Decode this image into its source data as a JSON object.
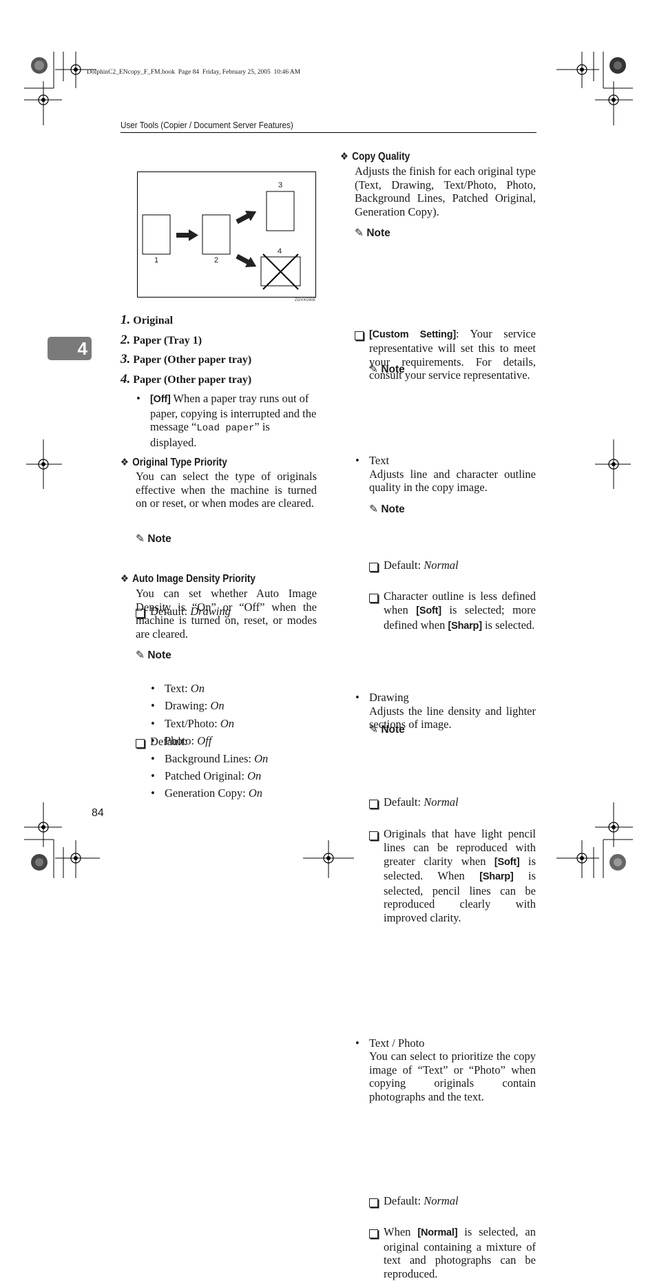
{
  "print_header": "DolphinC2_ENcopy_F_FM.book  Page 84  Friday, February 25, 2005  10:46 AM",
  "running_header": "User Tools (Copier / Document Server Features)",
  "chapter_tab": "4",
  "page_number": "84",
  "figure": {
    "labels": [
      "1",
      "2",
      "3",
      "4"
    ],
    "code": "ZGVX030E"
  },
  "numbered_items": [
    {
      "num": "1.",
      "text": "Original"
    },
    {
      "num": "2.",
      "text": "Paper (Tray 1)"
    },
    {
      "num": "3.",
      "text": "Paper (Other paper tray)"
    },
    {
      "num": "4.",
      "text": "Paper (Other paper tray)"
    }
  ],
  "off_item": {
    "button": "[Off]",
    "text1": " When a paper tray runs out of paper, copying is interrupted and the message “",
    "mono": "Load paper",
    "text2": "” is displayed."
  },
  "original_type_priority": {
    "heading": "Original Type Priority",
    "body": "You can select the type of originals effective when the machine is turned on or reset, or when modes are cleared.",
    "note_title": "Note",
    "note_label": "Default: ",
    "note_value": "Drawing"
  },
  "auto_image_density": {
    "heading": "Auto Image Density Priority",
    "body": "You can set whether Auto Image Density is “On” or “Off” when the machine is turned on, reset, or modes are cleared.",
    "note_title": "Note",
    "note_label": "Default:",
    "defaults": [
      {
        "label": "Text: ",
        "value": "On"
      },
      {
        "label": "Drawing: ",
        "value": "On"
      },
      {
        "label": "Text/Photo: ",
        "value": "On"
      },
      {
        "label": "Photo: ",
        "value": "Off"
      },
      {
        "label": "Background Lines: ",
        "value": "On"
      },
      {
        "label": "Patched Original: ",
        "value": "On"
      },
      {
        "label": "Generation Copy: ",
        "value": "On"
      }
    ]
  },
  "copy_quality": {
    "heading": "Copy Quality",
    "body": "Adjusts the finish for each original type (Text, Drawing, Text/Photo, Photo, Background Lines, Patched Original, Generation Copy).",
    "note_title": "Note",
    "custom_button": "[Custom Setting]",
    "custom_text": ": Your service representative will set this to meet your requirements. For details, consult your service representative.",
    "text_item": {
      "title": "Text",
      "body": "Adjusts line and character outline quality in the copy image.",
      "note_title": "Note",
      "default_label": "Default: ",
      "default_value": "Normal",
      "n2_a": "Character outline is less defined when ",
      "n2_soft": "[Soft]",
      "n2_b": " is selected; more defined when ",
      "n2_sharp": "[Sharp]",
      "n2_c": " is selected."
    },
    "drawing_item": {
      "title": "Drawing",
      "body": "Adjusts the line density and lighter sections of image.",
      "note_title": "Note",
      "default_label": "Default: ",
      "default_value": "Normal",
      "n2_a": "Originals that have light pencil lines can be reproduced with greater clarity when ",
      "n2_soft": "[Soft]",
      "n2_b": " is selected. When ",
      "n2_sharp": "[Sharp]",
      "n2_c": " is selected, pencil lines can be reproduced clearly with improved clarity."
    },
    "textphoto_item": {
      "title": "Text / Photo",
      "body": "You can select to prioritize the copy image of “Text” or “Photo” when copying originals contain photographs and the text.",
      "note_title": "Note",
      "default_label": "Default: ",
      "default_value": "Normal",
      "n2_a": "When ",
      "n2_normal": "[Normal]",
      "n2_b": " is selected, an original containing a mixture of text and photographs can be reproduced."
    }
  }
}
